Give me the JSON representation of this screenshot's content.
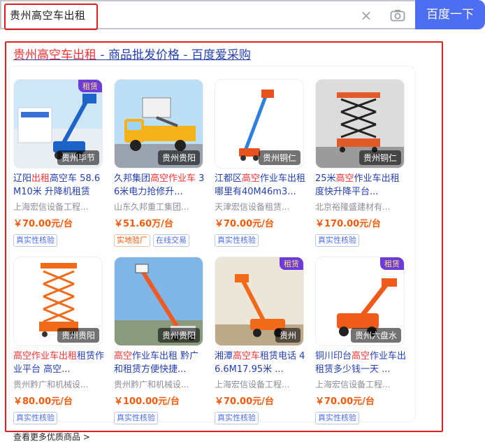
{
  "search": {
    "query": "贵州高空车出租",
    "button_label": "百度一下",
    "clear_icon": "close-icon",
    "camera_icon": "camera-icon"
  },
  "result": {
    "title_keyword": "贵州高空车出租",
    "title_rest": " - 商品批发价格 - 百度爱采购"
  },
  "products": [
    {
      "title_a": "辽阳",
      "title_b": "出租",
      "title_c": "高空车",
      "title_d": " 58.6M10米 升降机租赁",
      "region": "贵州毕节",
      "seller": "上海宏信设备工程...",
      "price": "￥70.00元/台",
      "badges": [
        "真实性核验"
      ],
      "rent_tag": "租赁",
      "thumb": "blue-boom"
    },
    {
      "title_a": "久邦集团",
      "title_b": "高空作业车",
      "title_c": "",
      "title_d": " 36米电力抢修升...",
      "region": "贵州贵阳",
      "seller": "山东久邦重工集团...",
      "price": "￥51.60万/台",
      "badges": [
        "实地验厂",
        "在线交易"
      ],
      "rent_tag": "",
      "thumb": "yellow-truck"
    },
    {
      "title_a": "江都区",
      "title_b": "高空",
      "title_c": "作业",
      "title_d": "车出租哪里有40M46m3...",
      "region": "贵州铜仁",
      "seller": "天津宏信设备租赁...",
      "price": "￥70.00元/台",
      "badges": [
        "真实性核验"
      ],
      "rent_tag": "",
      "thumb": "blue-mast"
    },
    {
      "title_a": "25米",
      "title_b": "高空",
      "title_c": "作业车出租",
      "title_d": "度快升降平台...",
      "region": "贵州铜仁",
      "seller": "北京裕隆盛建材有...",
      "price": "￥170.00元/台",
      "badges": [
        "真实性核验"
      ],
      "rent_tag": "",
      "thumb": "scissor-indoor"
    },
    {
      "title_a": "",
      "title_b": "高空作业车出租",
      "title_c": "租赁",
      "title_d": "作业平台 高空...",
      "region": "贵州贵阳",
      "seller": "贵州黔广和机械设...",
      "price": "￥80.00元/台",
      "badges": [
        "真实性核验"
      ],
      "rent_tag": "",
      "thumb": "orange-scissor"
    },
    {
      "title_a": "",
      "title_b": "高空",
      "title_c": "作业车出租",
      "title_d": " 黔广和租赁方便快捷...",
      "region": "贵州贵阳",
      "seller": "贵州黔广和机械设...",
      "price": "￥100.00元/台",
      "badges": [
        "真实性核验"
      ],
      "rent_tag": "",
      "thumb": "boom-sky"
    },
    {
      "title_a": "湘潭",
      "title_b": "高空车",
      "title_c": "租",
      "title_d": "赁电话 46.6M17.95米 ...",
      "region": "贵州",
      "seller": "上海宏信设备工程...",
      "price": "￥70.00元/台",
      "badges": [
        "真实性核验"
      ],
      "rent_tag": "租赁",
      "thumb": "orange-boom"
    },
    {
      "title_a": "铜川印台",
      "title_b": "高空",
      "title_c": "作业车出",
      "title_d": "租赁多少钱一天 ...",
      "region": "贵州六盘水",
      "seller": "上海宏信设备工程...",
      "price": "￥70.00元/台",
      "badges": [
        "真实性核验"
      ],
      "rent_tag": "租赁",
      "thumb": "red-boom"
    }
  ],
  "more_link": "查看更多优质商品 >",
  "colors": {
    "accent": "#4e6ef2",
    "keyword": "#f73131",
    "link": "#2440b3",
    "price": "#f55a0a",
    "highlight_box": "#e02020"
  }
}
